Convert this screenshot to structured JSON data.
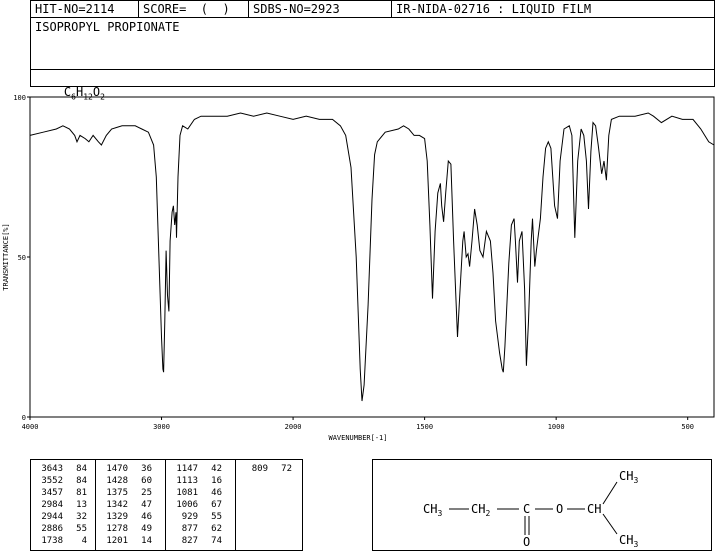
{
  "header": {
    "hit_no": "HIT-NO=2114",
    "score": "SCORE=  (  )",
    "sdbs_no": "SDBS-NO=2923",
    "ir_id": "IR-NIDA-02716 : LIQUID FILM"
  },
  "compound": {
    "name": "ISOPROPYL PROPIONATE",
    "formula_parts": [
      "C",
      "6",
      "H",
      "12",
      "O",
      "2"
    ]
  },
  "chart_data": {
    "type": "line",
    "xlabel": "WAVENUMBER[-1]",
    "ylabel": "TRANSMITTANCE[%]",
    "xlim": [
      4000,
      400
    ],
    "ylim": [
      0,
      100
    ],
    "x_ticks": [
      4000,
      3000,
      2000,
      1500,
      1000,
      500
    ],
    "y_ticks": [
      0,
      50,
      100
    ],
    "series": [
      {
        "points": [
          [
            4000,
            88
          ],
          [
            3900,
            89
          ],
          [
            3800,
            90
          ],
          [
            3750,
            91
          ],
          [
            3700,
            90
          ],
          [
            3660,
            88
          ],
          [
            3643,
            86
          ],
          [
            3620,
            88
          ],
          [
            3580,
            87
          ],
          [
            3552,
            86
          ],
          [
            3520,
            88
          ],
          [
            3480,
            86
          ],
          [
            3457,
            85
          ],
          [
            3420,
            88
          ],
          [
            3380,
            90
          ],
          [
            3300,
            91
          ],
          [
            3200,
            91
          ],
          [
            3150,
            90
          ],
          [
            3100,
            89
          ],
          [
            3060,
            85
          ],
          [
            3040,
            75
          ],
          [
            3020,
            50
          ],
          [
            3000,
            25
          ],
          [
            2990,
            15
          ],
          [
            2984,
            14
          ],
          [
            2975,
            30
          ],
          [
            2965,
            52
          ],
          [
            2955,
            38
          ],
          [
            2944,
            33
          ],
          [
            2935,
            55
          ],
          [
            2920,
            64
          ],
          [
            2910,
            66
          ],
          [
            2900,
            60
          ],
          [
            2890,
            64
          ],
          [
            2886,
            56
          ],
          [
            2875,
            75
          ],
          [
            2860,
            88
          ],
          [
            2840,
            91
          ],
          [
            2800,
            90
          ],
          [
            2750,
            93
          ],
          [
            2700,
            94
          ],
          [
            2600,
            94
          ],
          [
            2500,
            94
          ],
          [
            2400,
            95
          ],
          [
            2300,
            94
          ],
          [
            2200,
            95
          ],
          [
            2100,
            94
          ],
          [
            2000,
            93
          ],
          [
            1950,
            94
          ],
          [
            1900,
            93
          ],
          [
            1850,
            93
          ],
          [
            1820,
            91
          ],
          [
            1800,
            88
          ],
          [
            1780,
            78
          ],
          [
            1760,
            50
          ],
          [
            1745,
            15
          ],
          [
            1738,
            5
          ],
          [
            1730,
            10
          ],
          [
            1715,
            35
          ],
          [
            1700,
            68
          ],
          [
            1690,
            82
          ],
          [
            1680,
            86
          ],
          [
            1650,
            89
          ],
          [
            1600,
            90
          ],
          [
            1580,
            91
          ],
          [
            1560,
            90
          ],
          [
            1540,
            88
          ],
          [
            1520,
            88
          ],
          [
            1500,
            87
          ],
          [
            1490,
            80
          ],
          [
            1480,
            60
          ],
          [
            1470,
            37
          ],
          [
            1460,
            58
          ],
          [
            1450,
            70
          ],
          [
            1440,
            73
          ],
          [
            1435,
            66
          ],
          [
            1428,
            61
          ],
          [
            1420,
            70
          ],
          [
            1410,
            80
          ],
          [
            1400,
            79
          ],
          [
            1390,
            55
          ],
          [
            1375,
            25
          ],
          [
            1365,
            40
          ],
          [
            1355,
            55
          ],
          [
            1350,
            58
          ],
          [
            1342,
            50
          ],
          [
            1335,
            51
          ],
          [
            1329,
            47
          ],
          [
            1320,
            55
          ],
          [
            1310,
            65
          ],
          [
            1300,
            60
          ],
          [
            1290,
            52
          ],
          [
            1278,
            50
          ],
          [
            1265,
            58
          ],
          [
            1250,
            55
          ],
          [
            1240,
            45
          ],
          [
            1230,
            30
          ],
          [
            1215,
            20
          ],
          [
            1205,
            15
          ],
          [
            1201,
            14
          ],
          [
            1195,
            22
          ],
          [
            1180,
            48
          ],
          [
            1170,
            60
          ],
          [
            1160,
            62
          ],
          [
            1155,
            55
          ],
          [
            1147,
            42
          ],
          [
            1140,
            55
          ],
          [
            1130,
            58
          ],
          [
            1120,
            40
          ],
          [
            1113,
            16
          ],
          [
            1105,
            30
          ],
          [
            1095,
            55
          ],
          [
            1090,
            62
          ],
          [
            1081,
            47
          ],
          [
            1075,
            52
          ],
          [
            1060,
            62
          ],
          [
            1050,
            75
          ],
          [
            1040,
            84
          ],
          [
            1030,
            86
          ],
          [
            1020,
            84
          ],
          [
            1006,
            66
          ],
          [
            995,
            62
          ],
          [
            985,
            80
          ],
          [
            970,
            90
          ],
          [
            950,
            91
          ],
          [
            940,
            88
          ],
          [
            929,
            56
          ],
          [
            918,
            80
          ],
          [
            905,
            90
          ],
          [
            895,
            88
          ],
          [
            885,
            80
          ],
          [
            877,
            65
          ],
          [
            868,
            83
          ],
          [
            860,
            92
          ],
          [
            850,
            91
          ],
          [
            840,
            85
          ],
          [
            827,
            76
          ],
          [
            818,
            80
          ],
          [
            809,
            74
          ],
          [
            800,
            88
          ],
          [
            790,
            93
          ],
          [
            760,
            94
          ],
          [
            700,
            94
          ],
          [
            650,
            95
          ],
          [
            630,
            94
          ],
          [
            600,
            92
          ],
          [
            560,
            94
          ],
          [
            520,
            93
          ],
          [
            480,
            93
          ],
          [
            450,
            90
          ],
          [
            420,
            86
          ],
          [
            400,
            85
          ]
        ]
      }
    ]
  },
  "peaks": [
    [
      [
        "3643",
        "84"
      ],
      [
        "3552",
        "84"
      ],
      [
        "3457",
        "81"
      ],
      [
        "2984",
        "13"
      ],
      [
        "2944",
        "32"
      ],
      [
        "2886",
        "55"
      ],
      [
        "1738",
        "4"
      ]
    ],
    [
      [
        "1470",
        "36"
      ],
      [
        "1428",
        "60"
      ],
      [
        "1375",
        "25"
      ],
      [
        "1342",
        "47"
      ],
      [
        "1329",
        "46"
      ],
      [
        "1278",
        "49"
      ],
      [
        "1201",
        "14"
      ]
    ],
    [
      [
        "1147",
        "42"
      ],
      [
        "1113",
        "16"
      ],
      [
        "1081",
        "46"
      ],
      [
        "1006",
        "67"
      ],
      [
        "929",
        "55"
      ],
      [
        "877",
        "62"
      ],
      [
        "827",
        "74"
      ]
    ],
    [
      [
        "809",
        "72"
      ]
    ]
  ],
  "structure": {
    "ch3_left": "CH",
    "ch3_left_sub": "3",
    "ch2": "CH",
    "ch2_sub": "2",
    "carbonyl_c": "C",
    "ether_o": "O",
    "ch": "CH",
    "carbonyl_o": "O",
    "ch3_top": "CH",
    "ch3_top_sub": "3",
    "ch3_bottom": "CH",
    "ch3_bottom_sub": "3"
  }
}
